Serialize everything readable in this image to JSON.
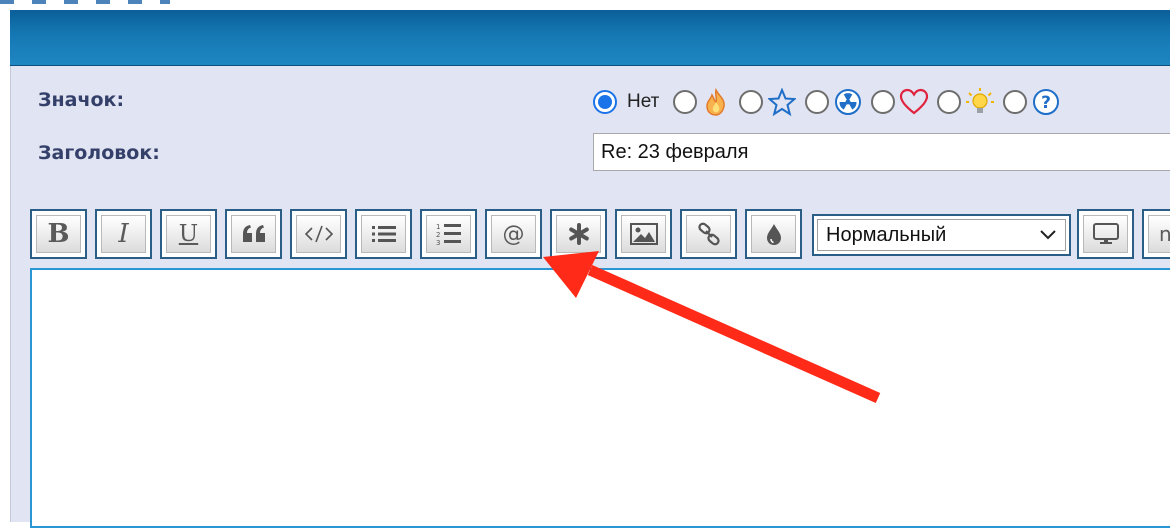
{
  "form": {
    "icon_label": "Значок:",
    "subject_label": "Заголовок:",
    "subject_value": "Re: 23 февраля",
    "icon_options": [
      {
        "name": "none",
        "label": "Нет",
        "selected": true
      },
      {
        "name": "fire-icon",
        "selected": false
      },
      {
        "name": "star-icon",
        "selected": false
      },
      {
        "name": "radiation-icon",
        "selected": false
      },
      {
        "name": "heart-icon",
        "selected": false
      },
      {
        "name": "lightbulb-icon",
        "selected": false
      },
      {
        "name": "question-icon",
        "selected": false
      }
    ]
  },
  "toolbar": {
    "bold": "B",
    "italic": "I",
    "underline": "U",
    "at_label": "@",
    "font_size_selected": "Нормальный",
    "cut_off_label": "n"
  },
  "colors": {
    "header_bar": "#1578b3",
    "panel_bg": "#e1e4f2",
    "label_text": "#34406a",
    "button_border": "#2a5e86",
    "editor_border": "#2a97d4",
    "annotation_arrow": "#ff2a17",
    "radio_selected": "#1a73e8"
  }
}
